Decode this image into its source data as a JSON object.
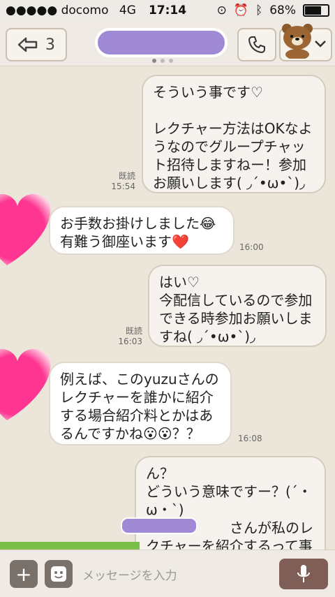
{
  "status": {
    "carrier": "●●●●● docomo",
    "network": "4G",
    "time": "17:14",
    "battery_text": "68%",
    "battery_level": 0.68
  },
  "header": {
    "back_count": "3",
    "call_icon": "phone-icon",
    "avatar": "brown-bear-icon"
  },
  "messages": [
    {
      "side": "out",
      "text": "そういう事です♡\n\nレクチャー方法はOKなようなのでグループチャット招待しますねー！参加お願いします( ◞´•ω•`)◞",
      "read": "既読",
      "time": "15:54"
    },
    {
      "side": "in",
      "text": "お手数お掛けしました😂\n有難う御座います❤️",
      "time": "16:00"
    },
    {
      "side": "out",
      "text": "はい♡\n今配信しているので参加できる時参加お願いしますね( ◞´•ω•`)◞",
      "read": "既読",
      "time": "16:03"
    },
    {
      "side": "in",
      "text": "例えば、このyuzuさんのレクチャーを誰かに紹介する場合紹介料とかはあるんですかね😮😮？？",
      "time": "16:08"
    },
    {
      "side": "out",
      "text": "ん？\nどういう意味ですー？(´・ω・`)\n　　　　　　さんが私のレクチャーを紹介するって事で"
    }
  ],
  "input": {
    "placeholder": "メッセージを入力"
  },
  "colors": {
    "accent": "#a08ad6",
    "heart": "#ff2d8d",
    "mic": "#7f5e57"
  }
}
